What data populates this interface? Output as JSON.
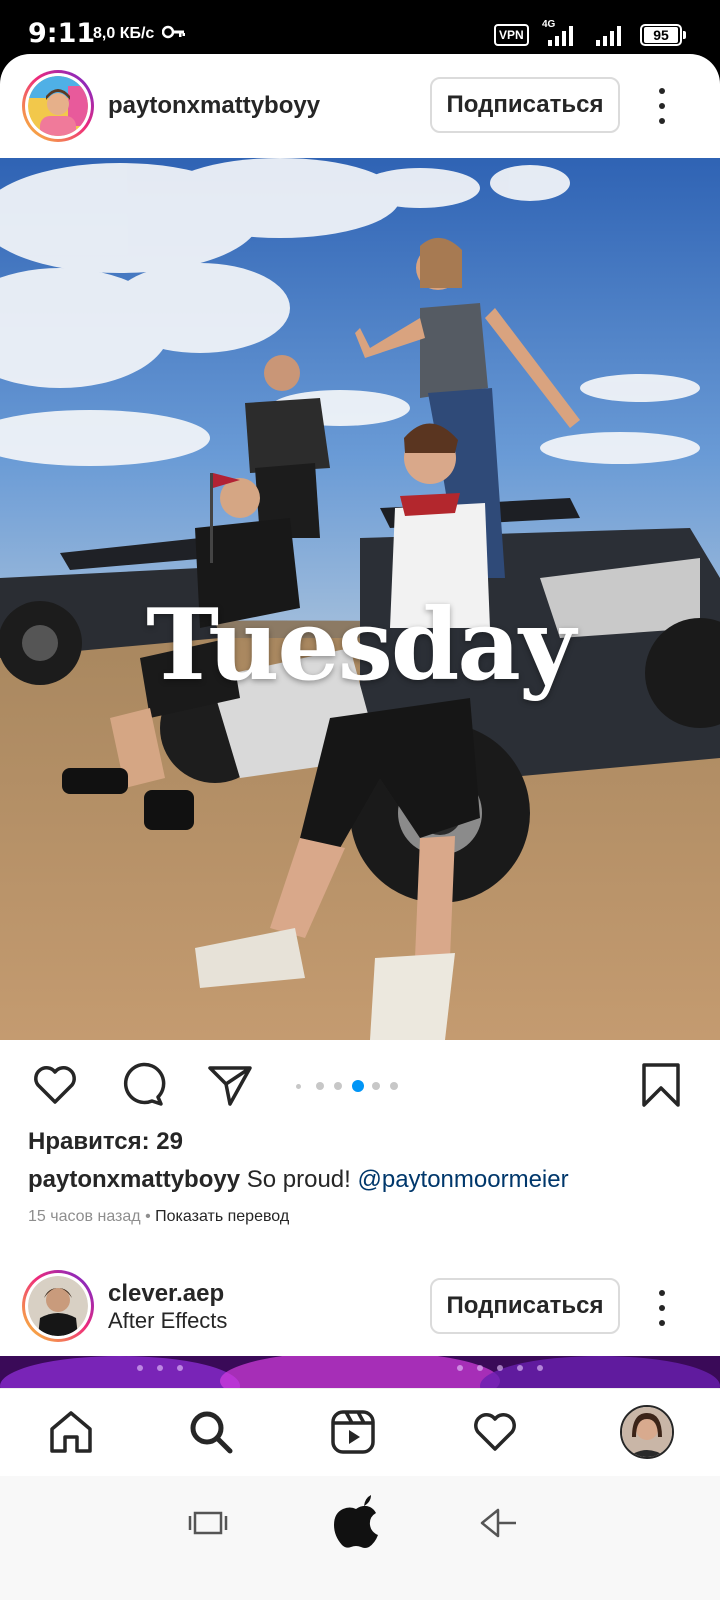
{
  "status_bar": {
    "time": "9:11",
    "net_speed": "8,0 КБ/с",
    "vpn": "VPN",
    "network": "4G",
    "battery": "95"
  },
  "post1": {
    "username": "paytonxmattyboyy",
    "subscribe_label": "Подписаться",
    "photo_text": "Tuesday",
    "likes": "Нравится: 29",
    "caption_user": "paytonxmattyboyy",
    "caption_text": "So proud!",
    "caption_mention": "@paytonmoormeier",
    "time_ago": "15 часов назад",
    "separator": "•",
    "translate_label": "Показать перевод",
    "carousel": {
      "count": 5,
      "active_index": 3
    }
  },
  "post2": {
    "username": "clever.aep",
    "subtitle": "After Effects",
    "subscribe_label": "Подписаться"
  },
  "icons": {
    "actions": [
      "heart-icon",
      "comment-icon",
      "share-icon",
      "bookmark-icon"
    ],
    "nav": [
      "home-icon",
      "search-icon",
      "reels-icon",
      "activity-heart-icon",
      "profile-avatar"
    ],
    "system": [
      "recents-icon",
      "home-apple-icon",
      "back-icon"
    ]
  },
  "colors": {
    "text": "#262626",
    "secondary": "#8e8e8e",
    "mention": "#00376b",
    "carousel_active": "#0095f6",
    "border": "#dbdbdb"
  }
}
